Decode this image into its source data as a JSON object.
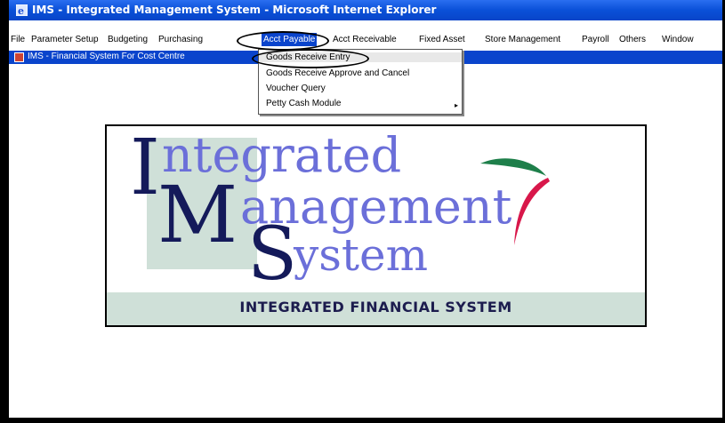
{
  "window": {
    "title": "IMS - Integrated Management System - Microsoft Internet Explorer"
  },
  "menu": {
    "items": [
      "File",
      "Parameter Setup",
      "Budgeting",
      "Purchasing",
      "Acct Payable",
      "Acct Receivable",
      "Fixed Asset",
      "Store Management",
      "Payroll",
      "Others",
      "Window"
    ],
    "active": "Acct Payable"
  },
  "mdi": {
    "title": "IMS - Financial System For Cost Centre"
  },
  "dropdown": {
    "items": [
      "Goods Receive Entry",
      "Goods Receive Approve and Cancel",
      "Voucher Query",
      "Petty Cash Module"
    ],
    "submenu_arrow": "▸"
  },
  "logo": {
    "letter_i": "I",
    "ntegrated": "ntegrated",
    "letter_m": "M",
    "anagement": "anagement",
    "letter_s": "S",
    "ystem": "ystem",
    "footer": "INTEGRATED FINANCIAL SYSTEM",
    "colors": {
      "navy": "#141a5a",
      "purple": "#6b6fd9",
      "band": "#cfe0d8",
      "red": "#d8174a",
      "green": "#1e7f4a"
    }
  }
}
